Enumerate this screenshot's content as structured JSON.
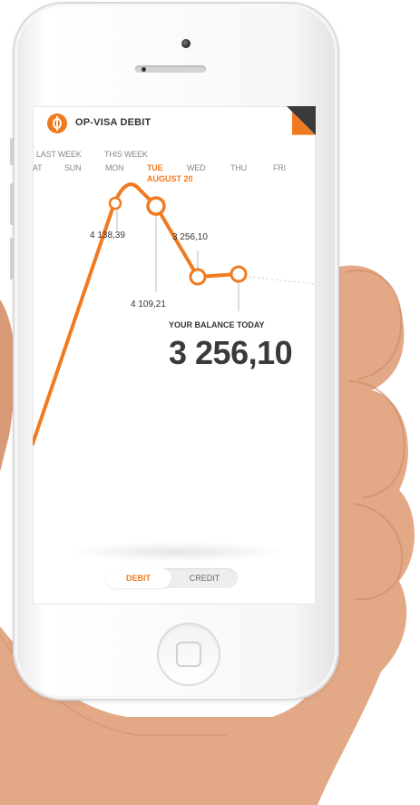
{
  "app": {
    "title": "OP-VISA DEBIT",
    "accent": "#f07a1f"
  },
  "week_labels": {
    "last_week": "LAST WEEK",
    "this_week": "THIS WEEK"
  },
  "days": [
    {
      "label": "AT"
    },
    {
      "label": "SUN"
    },
    {
      "label": "MON"
    },
    {
      "label": "TUE",
      "active": true
    },
    {
      "label": "WED"
    },
    {
      "label": "THU"
    },
    {
      "label": "FRI"
    }
  ],
  "selected_date": "AUGUST 20",
  "chart_data": {
    "type": "line",
    "points": [
      {
        "label": "4 138,39"
      },
      {
        "label": "4 109,21"
      },
      {
        "label": "3 256,10"
      }
    ]
  },
  "balance": {
    "label": "YOUR BALANCE TODAY",
    "value": "3 256,10"
  },
  "toggle": {
    "debit": "DEBIT",
    "credit": "CREDIT",
    "selected": "DEBIT"
  }
}
